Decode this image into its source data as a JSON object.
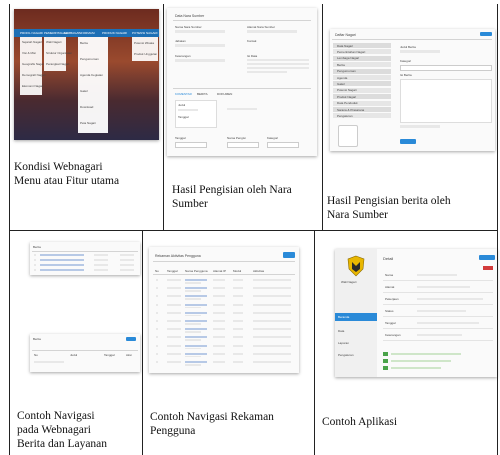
{
  "captions": {
    "c1": [
      "Kondisi Webnagari",
      "Menu atau Fitur utama"
    ],
    "c2": [
      "Hasil Pengisian oleh Nara",
      "Sumber"
    ],
    "c3": [
      "Hasil Pengisian berita  oleh",
      "Nara Sumber"
    ],
    "c4": [
      "Contoh Navigasi",
      "pada Webnagari",
      "Berita dan Layanan"
    ],
    "c5": [
      "Contoh Navigasi Rekaman",
      "Pengguna"
    ],
    "c6": [
      "Contoh Aplikasi"
    ]
  },
  "shot1": {
    "menu": [
      "PROFIL NAGARI",
      "PEMERINTAHAN",
      "LEMBAGA",
      "INFORMASI",
      "PRODUK NAGARI",
      "POTENSI NAGARI"
    ],
    "profil_items": [
      "Sejarah Nagari",
      "Visi & Misi",
      "Geografis Nagari",
      "Demografi Nagari",
      "Ekonomi Nagari"
    ],
    "pemerintahan_items": [
      "Wali Nagari",
      "Struktur Organisasi",
      "Perangkat Nagari"
    ],
    "informasi_items": [
      "Berita",
      "Pengumuman",
      "Agenda Kegiatan",
      "Galeri",
      "Download",
      "Peta Nagari"
    ],
    "produk_items": [
      "Produk Unggulan"
    ],
    "potensi_items": [
      "Potensi Wisata"
    ]
  },
  "shot2": {
    "title": "Data Nara Sumber",
    "labels": [
      "Nama Nara Sumber",
      "Alamat Nara Sumber",
      "Jabatan",
      "Kontak",
      "Keterangan",
      "Judul",
      "Tanggal",
      "Isi Data"
    ],
    "tabs": [
      "KOMENTAR",
      "BERITA",
      "DOKUMEN"
    ],
    "footer_labels": [
      "Tanggal",
      "Nama Pengisi",
      "Kategori"
    ]
  },
  "shot3": {
    "title": "Daftar Nagari",
    "button": "Tambah",
    "sidebar_items": [
      "Data Nagari",
      "Pemerintahan Nagari",
      "Lembaga Nagari",
      "Berita",
      "Pengumuman",
      "Agenda",
      "Galeri",
      "Potensi Nagari",
      "Produk Nagari",
      "Data Penduduk",
      "Sarana & Prasarana",
      "Pengaturan"
    ],
    "form_labels": [
      "Judul Berita",
      "Kategori",
      "Isi Berita"
    ],
    "save": "Simpan"
  },
  "shot4": {
    "rows": 4,
    "title": "Berita",
    "headers": [
      "No",
      "Judul",
      "Tanggal",
      "Aksi"
    ]
  },
  "shot5": {
    "title": "Rekaman Aktivitas Pengguna",
    "button": "Cetak",
    "headers": [
      "No",
      "Tanggal",
      "Nama Pengguna",
      "Alamat IP",
      "Modul",
      "Aktivitas"
    ],
    "row_count": 11
  },
  "shot6": {
    "org": "Wali Nagari",
    "title": "Detail",
    "fields": [
      "Nama",
      "Alamat",
      "Pekerjaan",
      "Status",
      "Tanggal",
      "Keterangan"
    ],
    "sidebar": [
      "Beranda",
      "Data",
      "Laporan",
      "Pengaturan"
    ],
    "colors": {
      "accent": "#2a8ad8",
      "green": "#4aa34a",
      "red": "#d23b3b"
    }
  }
}
